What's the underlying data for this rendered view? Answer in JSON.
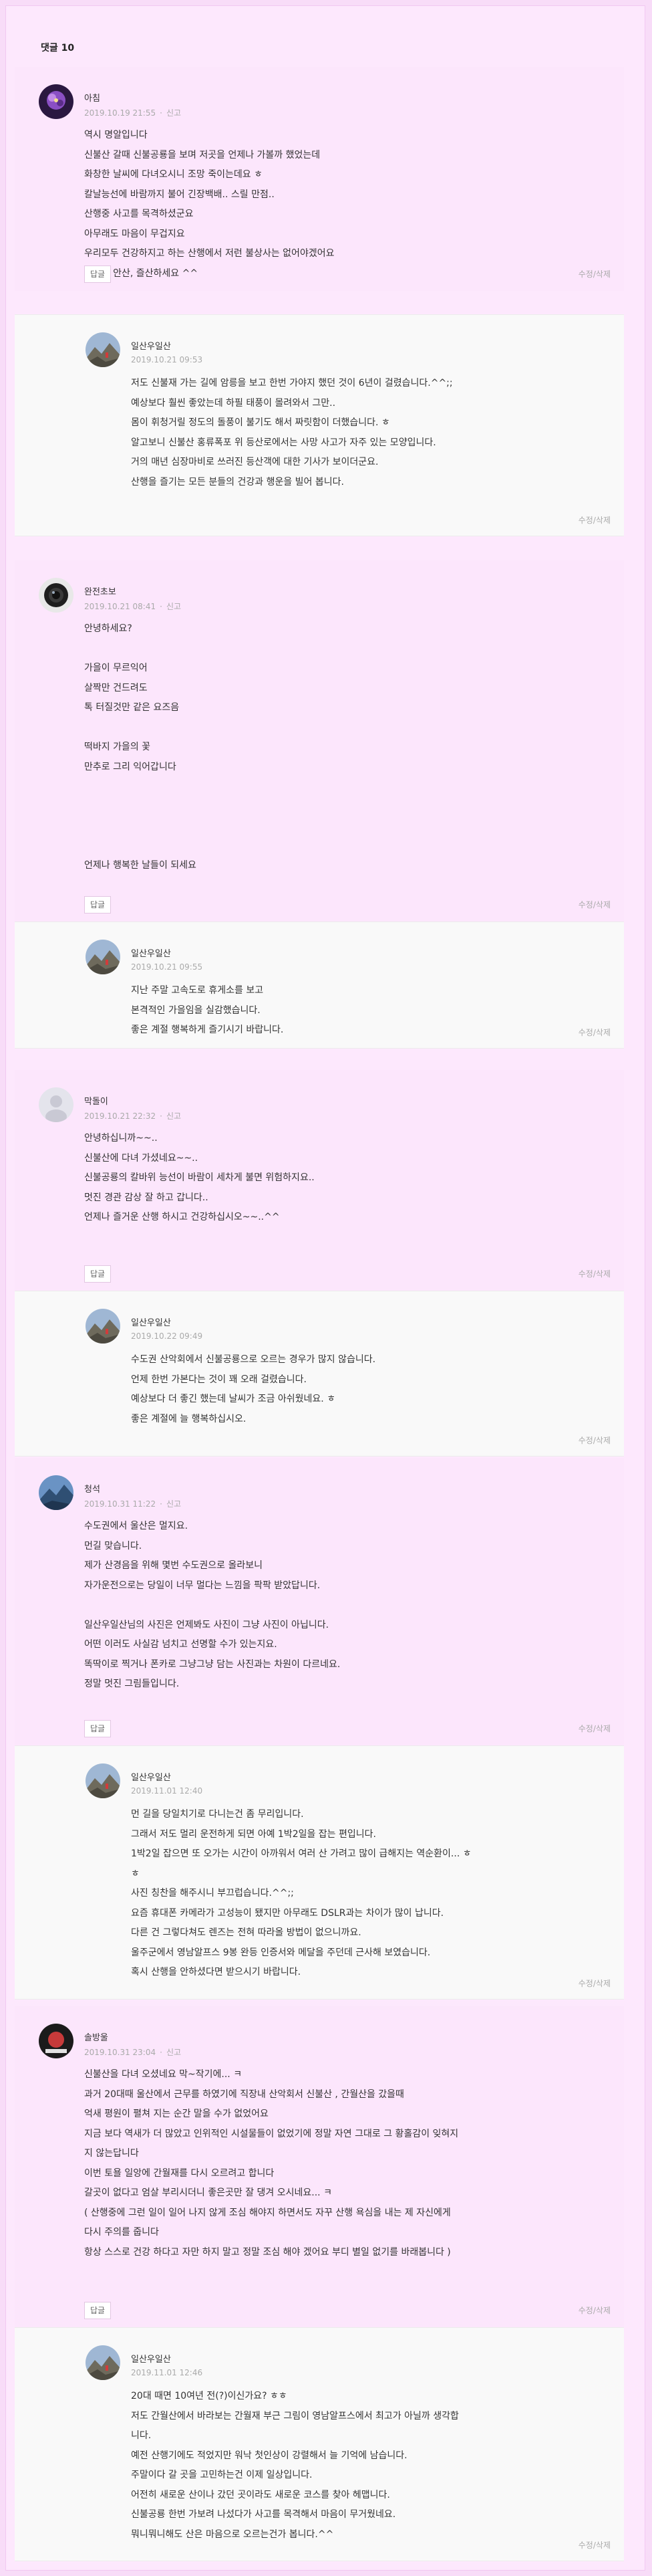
{
  "comment_count_label": "댓글 10",
  "labels": {
    "report": "신고",
    "reply": "답글",
    "edit": "수정",
    "delete": "삭제",
    "edit_sep": "/"
  },
  "comments": [
    {
      "name": "아침",
      "date": "2019.10.19 21:55",
      "lines": [
        "역시 명알입니다",
        "신불산 갈때 신불공룡을 보며 저곳을 언제나 가볼까 했었는데",
        "화창한 날씨에 다녀오시니 조망 죽이는데요 ㅎ",
        "칼날능선에 바람까지 불어 긴장백배.. 스릴 만점..",
        "산행중 사고를 목격하셨군요",
        "아무래도 마음이 무겁지요",
        "우리모두 건강하지고 하는 산행에서 저런 불상사는 없어야겠어요",
        "언제나 안산, 즐산하세요 ^^"
      ]
    },
    {
      "name": "일산우일산",
      "date": "2019.10.21 09:53",
      "lines": [
        "저도 신불재 가는 길에 암릉을 보고 한번 가야지 했던 것이 6년이 걸렸습니다.^^;;",
        "예상보다 훨씬 좋았는데 하필 태풍이 몰려와서 그만..",
        "몸이 휘청거릴 정도의 돌풍이 불기도 해서 짜릿함이 더했습니다. ㅎ",
        "알고보니 신불산 홍류폭포 위 등산로에서는 사망 사고가 자주 있는 모양입니다.",
        "거의 매년 심장마비로 쓰러진 등산객에 대한 기사가 보이더군요.",
        "산행을 즐기는 모든 분들의 건강과 행운을 빌어 봅니다."
      ]
    },
    {
      "name": "완전초보",
      "date": "2019.10.21 08:41",
      "lines": [
        "안녕하세요?",
        "",
        "가을이 무르익어",
        "살짝만 건드려도",
        "톡 터질것만 같은 요즈음",
        "",
        "떡바지 가을의 꽃",
        "만추로 그리 익어갑니다",
        "",
        "",
        "",
        "",
        "언제나 행복한 날들이 되세요"
      ]
    },
    {
      "name": "일산우일산",
      "date": "2019.10.21 09:55",
      "lines": [
        "지난 주말 고속도로 휴게소를 보고",
        "본격적인 가을임을 실감했습니다.",
        "좋은 계절 행복하게 즐기시기 바랍니다."
      ]
    },
    {
      "name": "막돌이",
      "date": "2019.10.21 22:32",
      "lines": [
        "안녕하십니까~~..",
        "신불산에 다녀 가셨네요~~..",
        "신불공룡의 칼바위 능선이 바람이 세차게 불면 위험하지요..",
        "멋진 경관 감상 잘 하고 갑니다..",
        "언제나 즐거운 산행 하시고 건강하십시오~~..^^"
      ]
    },
    {
      "name": "일산우일산",
      "date": "2019.10.22 09:49",
      "lines": [
        "수도권 산악회에서 신불공룡으로 오르는 경우가 많지 않습니다.",
        "언제 한번 가본다는 것이 꽤 오래 걸렸습니다.",
        "예상보다 더 좋긴 했는데 날씨가 조금 아쉬웠네요. ㅎ",
        "좋은 계절에 늘 행복하십시오."
      ]
    },
    {
      "name": "청석",
      "date": "2019.10.31 11:22",
      "lines": [
        "수도권에서 울산은 멀지요.",
        "먼길 맞습니다.",
        "제가 산경음을 위해 몇번 수도권으로 올라보니",
        "자가운전으로는 당일이 너무 멀다는 느낌을 팍팍 받았답니다.",
        "",
        "일산우일산님의 사진은 언제봐도 사진이 그냥 사진이 아닙니다.",
        "어떤 이러도 사실감 넘치고 선명할 수가 있는지요.",
        "똑딱이로 찍거나 폰카로 그냥그냥 담는 사진과는 차원이 다르네요.",
        "정말 멋진 그림들입니다."
      ]
    },
    {
      "name": "일산우일산",
      "date": "2019.11.01 12:40",
      "lines": [
        "먼 길을 당일치기로 다니는건 좀 무리입니다.",
        "그래서 저도 멀리 운전하게 되면 아예 1박2일을 잡는 편입니다.",
        "1박2일 잡으면 또 오가는 시간이 아까워서 여러 산 가려고 많이 급해지는 역순환이... ㅎ",
        "ㅎ",
        "사진 칭찬을 해주시니 부끄럽습니다.^^;;",
        "요즘 휴대폰 카메라가 고성능이 됐지만 아무래도 DSLR과는 차이가 많이 납니다.",
        "다른 건 그렇다쳐도 렌즈는 전혀 따라올 방법이 없으니까요.",
        "울주군에서 영남알프스 9봉 완등 인증서와 메달을 주던데 근사해 보였습니다.",
        "혹시 산행을 안하셨다면 받으시기 바랍니다."
      ]
    },
    {
      "name": "솔방울",
      "date": "2019.10.31 23:04",
      "lines": [
        "신불산을 다녀 오셨네요 막~작기에... ㅋ",
        "과거 20대때 울산에서 근무를 하였기에 직장내 산악회서 신불산 , 간월산을 갔을때",
        "억새 평원이 펼쳐 지는 순간 말을 수가 없었어요",
        "지금 보다 역새가 더 많았고 인위적인 시설물들이 없었기에 정말 자연 그대로 그 황홀감이 잊혀지",
        "지 않는답니다",
        "이번 토욜 일앙에 간월재를 다시 오르려고 합니다",
        "갈곳이 없다고 엄살 부리시더니 좋은곳만 잘 댕겨 오시네요... ㅋ",
        "( 산행중에 그런 일이 일어 나지 않게 조심 해야지 하면서도 자꾸 산행 욕심을 내는 제 자신에게",
        "다시 주의를 줍니다",
        "항상 스스로 건강 하다고 자만 하지 말고 정말 조심 해야 겠어요 부디 별일 없기를 바래봅니다 )"
      ]
    },
    {
      "name": "일산우일산",
      "date": "2019.11.01 12:46",
      "lines": [
        "20대 때면 10여년 전(?)이신가요? ㅎㅎ",
        "저도 간월산에서 바라보는 간월재 부근 그림이 영남알프스에서 최고가 아닐까 생각합",
        "니다.",
        "예전 산행기에도 적었지만 워낙 첫인상이 강렬해서 늘 기억에 남습니다.",
        "주말이다 갈 곳을 고민하는건 이제 일상입니다.",
        "어전히 새로운 산이나 갔던 곳이라도 새로운 코스를 찾아 헤맵니다.",
        "신불공룡 한번 가보려 나섰다가 사고를 목격해서 마음이 무거웠네요.",
        "뭐니뭐니해도 산은 마음으로 오르는건가 봅니다.^^"
      ]
    }
  ]
}
